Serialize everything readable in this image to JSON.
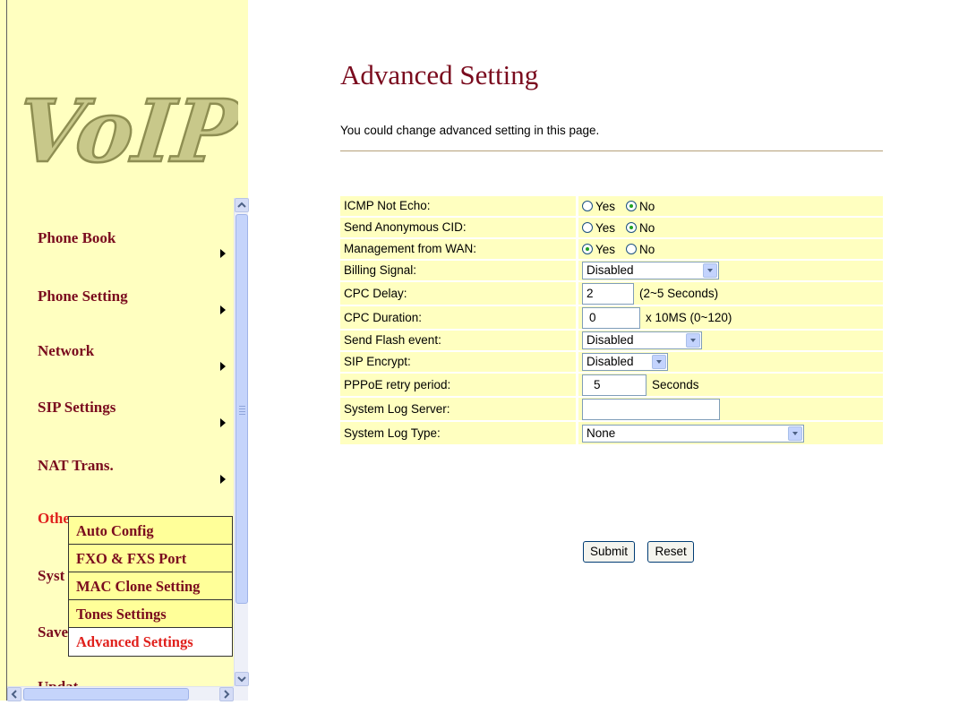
{
  "logo": {
    "text": "VoIP"
  },
  "nav": {
    "items": [
      {
        "label": "Phone Book",
        "has_submenu": true
      },
      {
        "label": "Phone Setting",
        "has_submenu": true
      },
      {
        "label": "Network",
        "has_submenu": true
      },
      {
        "label": "SIP Settings",
        "has_submenu": true
      },
      {
        "label": "NAT Trans.",
        "has_submenu": true
      },
      {
        "label": "Othe",
        "highlighted": true
      },
      {
        "label": "Syst"
      },
      {
        "label": "Save"
      },
      {
        "label": "Updat"
      }
    ],
    "submenu": [
      {
        "label": "Auto Config"
      },
      {
        "label": "FXO & FXS Port"
      },
      {
        "label": "MAC Clone Setting"
      },
      {
        "label": "Tones Settings"
      },
      {
        "label": "Advanced Settings",
        "active": true
      }
    ]
  },
  "page": {
    "title": "Advanced Setting",
    "description": "You could change advanced setting in this page."
  },
  "settings": {
    "icmp_not_echo": {
      "label": "ICMP Not Echo:",
      "options": [
        "Yes",
        "No"
      ],
      "selected": "No"
    },
    "send_anonymous_cid": {
      "label": "Send Anonymous CID:",
      "options": [
        "Yes",
        "No"
      ],
      "selected": "No"
    },
    "management_from_wan": {
      "label": "Management from WAN:",
      "options": [
        "Yes",
        "No"
      ],
      "selected": "Yes"
    },
    "billing_signal": {
      "label": "Billing Signal:",
      "value": "Disabled"
    },
    "cpc_delay": {
      "label": "CPC Delay:",
      "value": "2",
      "unit": "(2~5 Seconds)"
    },
    "cpc_duration": {
      "label": "CPC Duration:",
      "value": "0",
      "unit": "x 10MS (0~120)"
    },
    "send_flash_event": {
      "label": "Send Flash event:",
      "value": "Disabled"
    },
    "sip_encrypt": {
      "label": "SIP Encrypt:",
      "value": "Disabled"
    },
    "pppoe_retry_period": {
      "label": "PPPoE retry period:",
      "value": "5",
      "unit": "Seconds"
    },
    "system_log_server": {
      "label": "System Log Server:",
      "value": ""
    },
    "system_log_type": {
      "label": "System Log Type:",
      "value": "None"
    }
  },
  "buttons": {
    "submit": "Submit",
    "reset": "Reset"
  },
  "colors": {
    "panel_bg": "#ffffc0",
    "nav_text": "#7a0b1e",
    "active_text": "#e0201c",
    "title": "#7a0b1e"
  },
  "icons": [
    "voip-logo",
    "submenu-arrow-icon",
    "scroll-up-icon",
    "scroll-down-icon",
    "scroll-left-icon",
    "scroll-right-icon",
    "dropdown-arrow-icon"
  ]
}
